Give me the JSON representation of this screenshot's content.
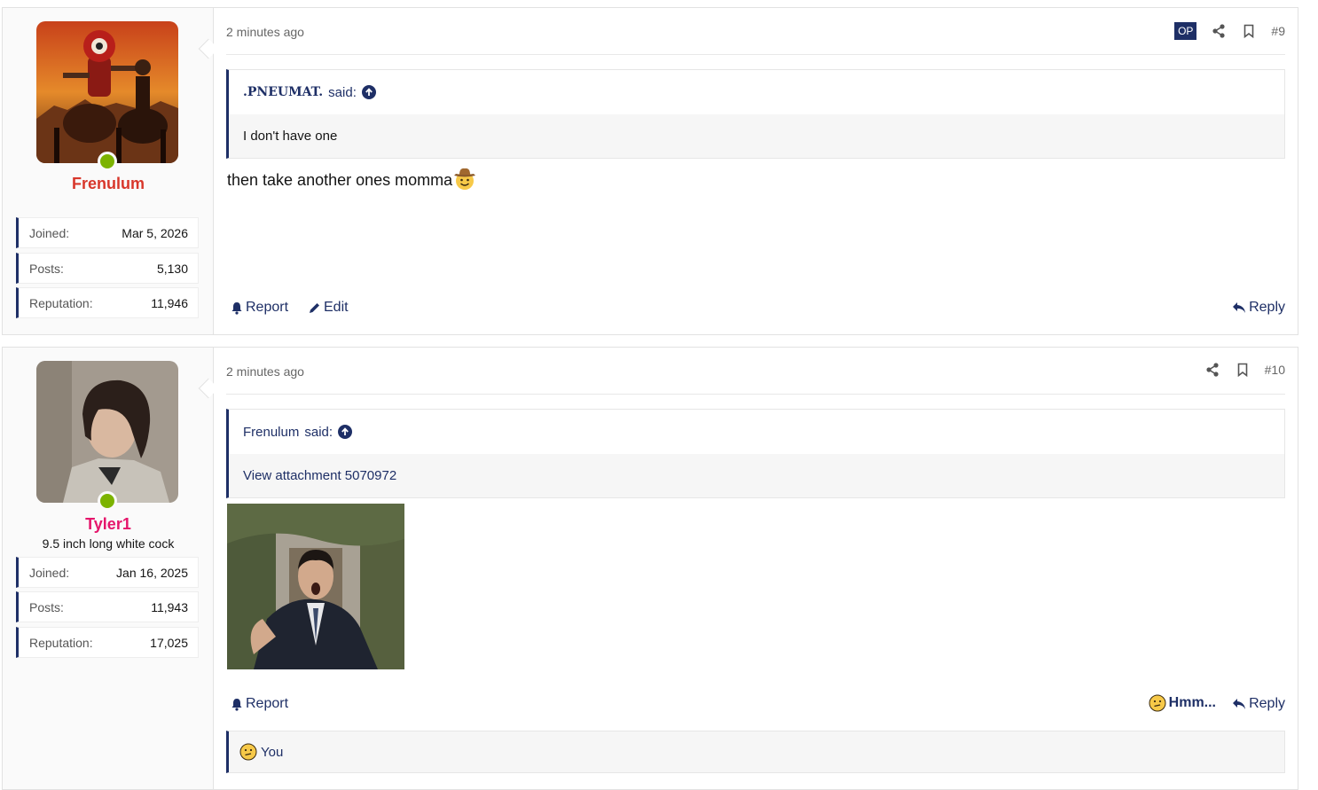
{
  "posts": [
    {
      "username": "Frenulum",
      "user_title": "",
      "avatar_icon": "cowboy-rider-avatar",
      "stats": [
        {
          "label": "Joined:",
          "value": "Mar 5, 2026"
        },
        {
          "label": "Posts:",
          "value": "5,130"
        },
        {
          "label": "Reputation:",
          "value": "11,946"
        }
      ],
      "time": "2 minutes ago",
      "op_badge": "OP",
      "post_number": "#9",
      "quote": {
        "author": ".PNEUMAT.",
        "said_label": "said:",
        "text": "I don't have one"
      },
      "message": "then take another ones momma",
      "message_emoji": "cowboy-emoji",
      "actions": {
        "report": "Report",
        "edit": "Edit",
        "reply": "Reply"
      }
    },
    {
      "username": "Tyler1",
      "user_title": "9.5 inch long white cock",
      "avatar_icon": "dark-haired-man-avatar",
      "stats": [
        {
          "label": "Joined:",
          "value": "Jan 16, 2025"
        },
        {
          "label": "Posts:",
          "value": "11,943"
        },
        {
          "label": "Reputation:",
          "value": "17,025"
        }
      ],
      "time": "2 minutes ago",
      "post_number": "#10",
      "quote": {
        "author": "Frenulum",
        "said_label": "said:",
        "text": "View attachment 5070972"
      },
      "attachment_icon": "shocked-man-gif",
      "actions": {
        "report": "Report",
        "reaction": "Hmm...",
        "reply": "Reply"
      },
      "reactions_text": "You"
    }
  ],
  "colors": {
    "accent": "#1e2f66",
    "username_red": "#d8372b",
    "username_pink": "#e5166b",
    "online": "#7cb300"
  }
}
